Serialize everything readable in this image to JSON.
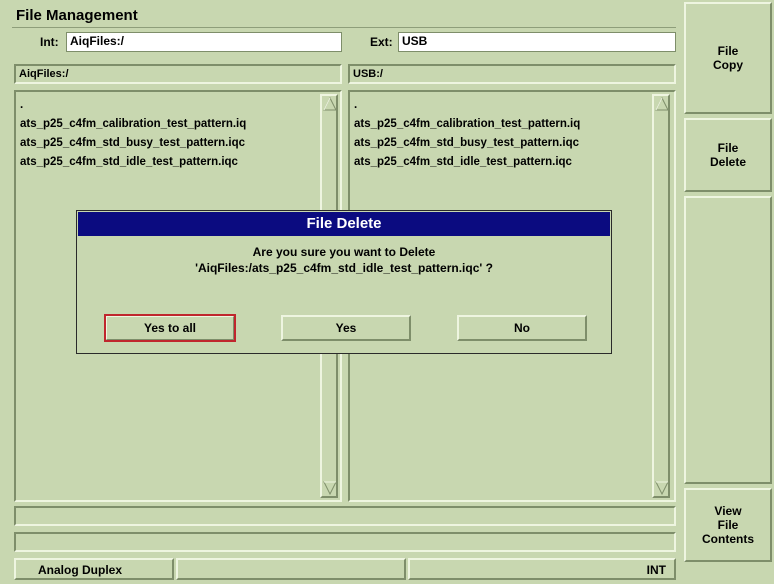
{
  "window": {
    "title": "File Management"
  },
  "sidebar": {
    "copy": "File\nCopy",
    "delete": "File\nDelete",
    "view": "View\nFile\nContents"
  },
  "int": {
    "label": "Int:",
    "value": "AiqFiles:/",
    "path": "AiqFiles:/"
  },
  "ext": {
    "label": "Ext:",
    "value": "USB",
    "path": "USB:/"
  },
  "left_list": {
    "items": [
      ".",
      "ats_p25_c4fm_calibration_test_pattern.iq",
      "ats_p25_c4fm_std_busy_test_pattern.iqc",
      "ats_p25_c4fm_std_idle_test_pattern.iqc"
    ]
  },
  "right_list": {
    "items": [
      ".",
      "ats_p25_c4fm_calibration_test_pattern.iq",
      "ats_p25_c4fm_std_busy_test_pattern.iqc",
      "ats_p25_c4fm_std_idle_test_pattern.iqc"
    ]
  },
  "dialog": {
    "title": "File Delete",
    "line1": "Are you sure you want to Delete",
    "line2": "'AiqFiles:/ats_p25_c4fm_std_idle_test_pattern.iqc' ?",
    "yes_all": "Yes to all",
    "yes": "Yes",
    "no": "No"
  },
  "status": {
    "mode": "Analog Duplex",
    "source": "INT"
  }
}
